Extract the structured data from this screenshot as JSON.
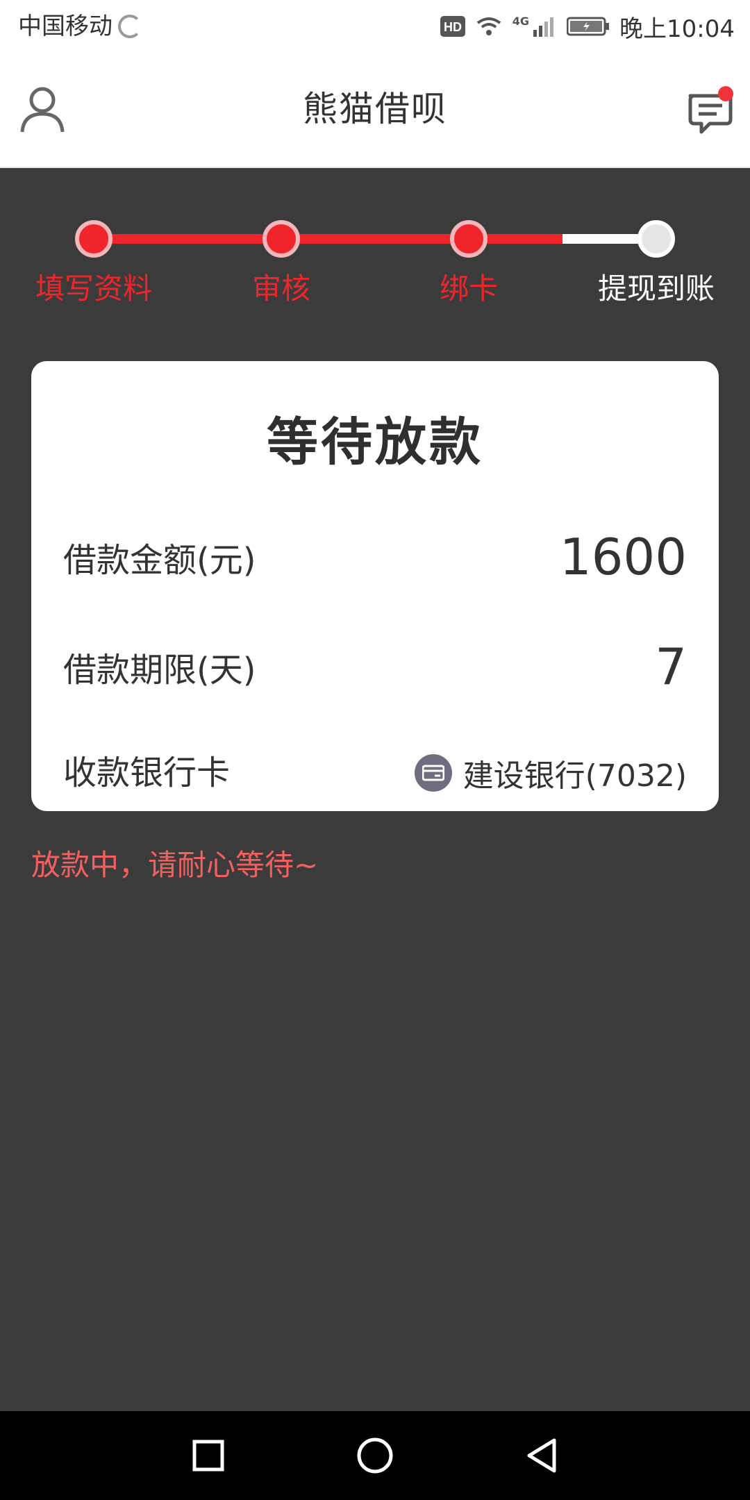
{
  "status_bar": {
    "carrier": "中国移动",
    "network": "4G",
    "time": "晚上10:04"
  },
  "header": {
    "title": "熊猫借呗"
  },
  "steps": [
    {
      "label": "填写资料",
      "done": true
    },
    {
      "label": "审核",
      "done": true
    },
    {
      "label": "绑卡",
      "done": true
    },
    {
      "label": "提现到账",
      "done": false
    }
  ],
  "card": {
    "title": "等待放款",
    "amount_label": "借款金额(元)",
    "amount_value": "1600",
    "term_label": "借款期限(天)",
    "term_value": "7",
    "bank_label": "收款银行卡",
    "bank_value": "建设银行(7032)"
  },
  "status_message": "放款中，请耐心等待~",
  "colors": {
    "accent_red": "#f0242b",
    "background": "#3b3b3b",
    "message_red": "#f26060"
  },
  "icons": {
    "user": "user-icon",
    "message": "message-icon",
    "bank": "bank-card-icon",
    "nav_recent": "square-icon",
    "nav_home": "circle-icon",
    "nav_back": "triangle-back-icon"
  }
}
